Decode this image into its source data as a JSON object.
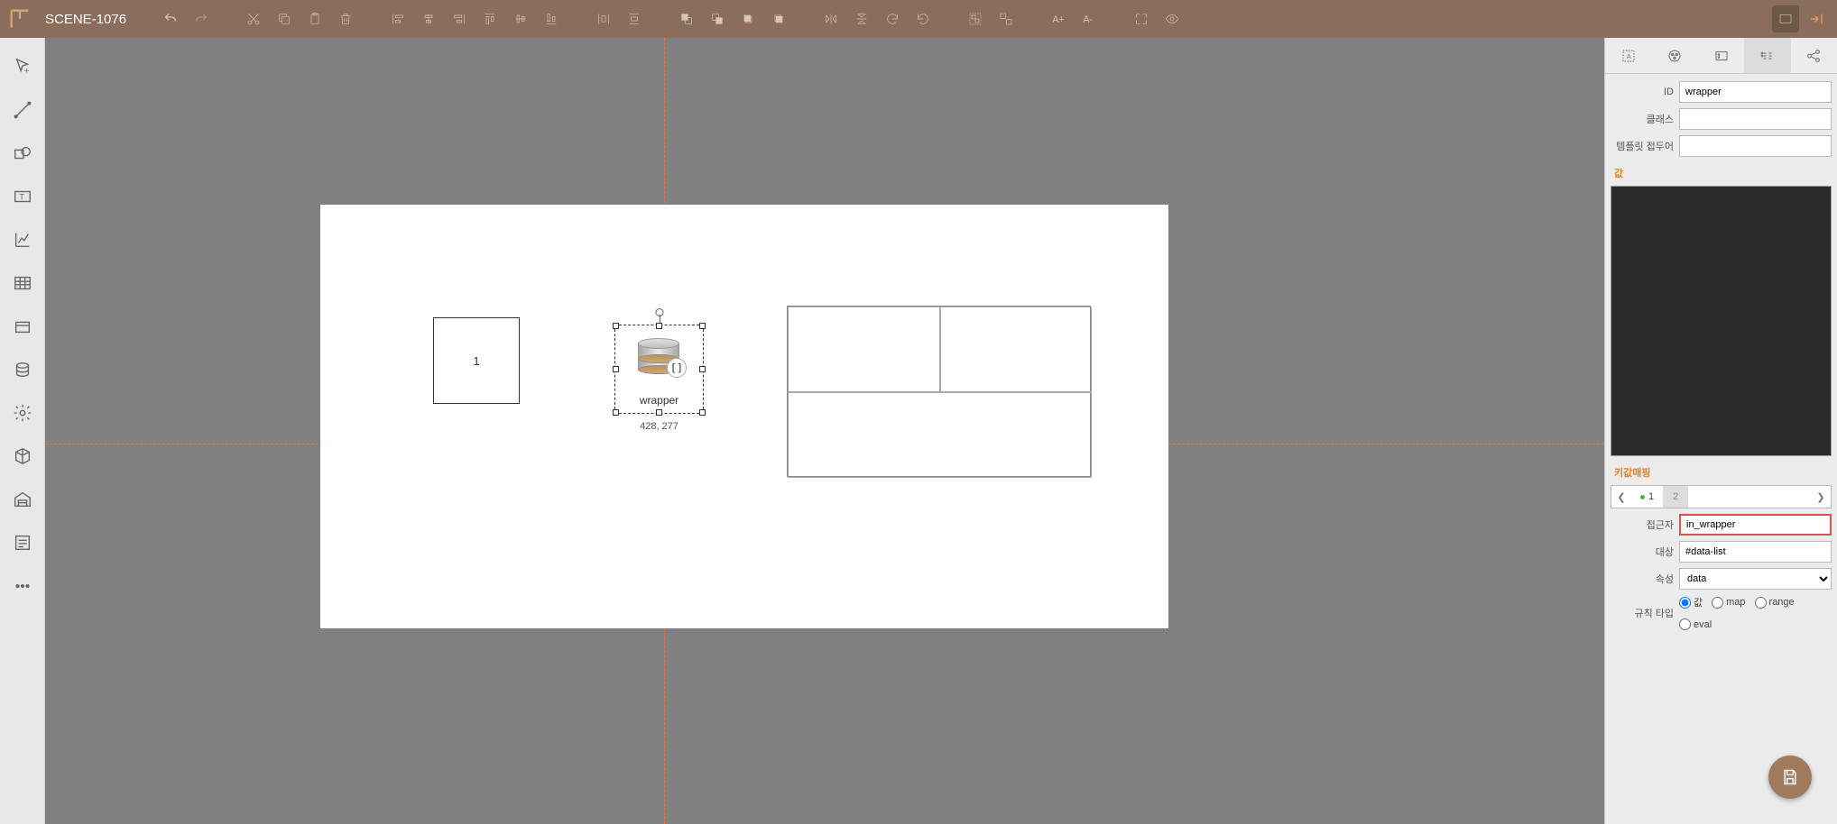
{
  "topbar": {
    "title": "SCENE-1076"
  },
  "canvas": {
    "box1_text": "1",
    "wrapper_label": "wrapper",
    "wrapper_badge": "[ ]",
    "coords": "428, 277"
  },
  "panel": {
    "id_label": "ID",
    "id_value": "wrapper",
    "class_label": "클래스",
    "class_value": "",
    "tmpl_prefix_label": "템플릿 접두어",
    "tmpl_prefix_value": "",
    "section_value": "값",
    "section_kvmap": "키값매핑",
    "kvtab1": "1",
    "kvtab2": "2",
    "accessor_label": "접근자",
    "accessor_value": "in_wrapper",
    "target_label": "대상",
    "target_value": "#data-list",
    "attribute_label": "속성",
    "attribute_value": "data",
    "ruletype_label": "규칙 타입",
    "rule_val": "값",
    "rule_map": "map",
    "rule_range": "range",
    "rule_eval": "eval"
  }
}
